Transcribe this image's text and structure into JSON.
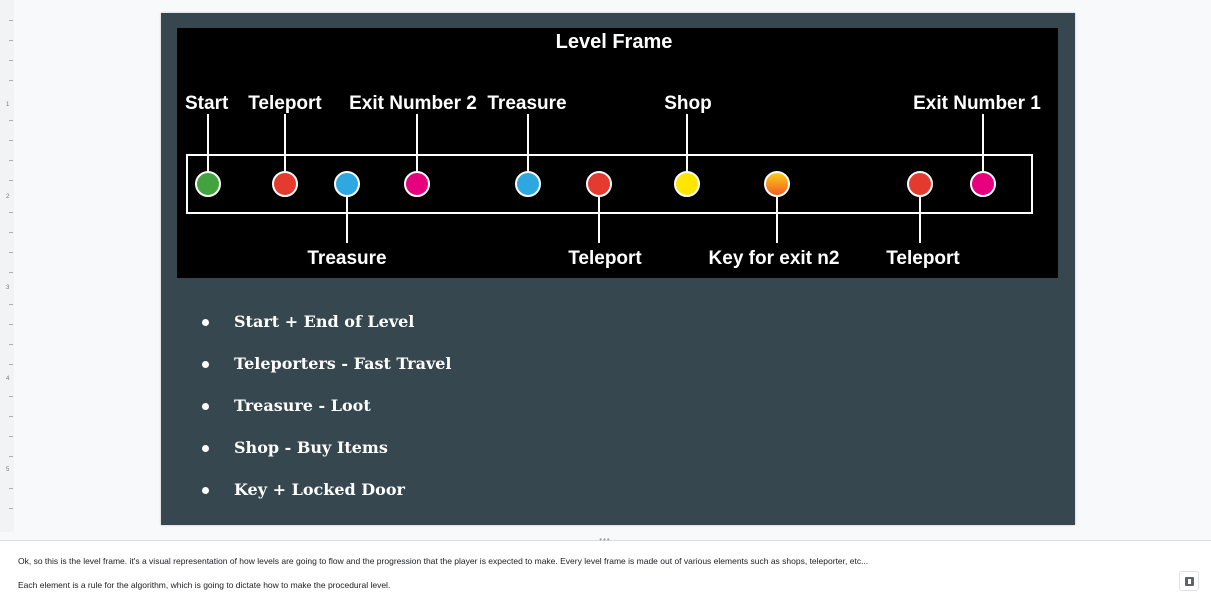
{
  "slide": {
    "frame_title": "Level Frame",
    "frame_colors": {
      "background": "#000000",
      "start": "#43a33f",
      "teleport": "#e53a2f",
      "treasure": "#2ea8e0",
      "exit": "#e6007e",
      "shop": "#ffe500",
      "key_top": "#ffd21a",
      "key_bottom": "#f05a23"
    },
    "top_labels": [
      "Start",
      "Teleport",
      "Exit Number 2",
      "Treasure",
      "Shop",
      "Exit Number 1"
    ],
    "bottom_labels": [
      "Treasure",
      "Teleport",
      "Key for exit n2",
      "Teleport"
    ],
    "bullets": [
      "Start + End of Level",
      "Teleporters - Fast Travel",
      "Treasure - Loot",
      "Shop - Buy Items",
      "Key + Locked Door"
    ],
    "background": "#37474f"
  },
  "speaker_notes": {
    "line1": "Ok, so this is the level frame. it's a visual representation of how levels are going to flow and the progression that the player is expected to make. Every level frame is made out of various elements such as shops, teleporter, etc...",
    "line2": "Each element is a rule for the algorithm, which is going to dictate how to make the procedural level."
  },
  "ruler": {
    "numbers": [
      "1",
      "2",
      "3",
      "4",
      "5"
    ]
  },
  "icons": {
    "notes_button": "speaker-notes-icon",
    "resize_grip": "resize-grip-icon"
  }
}
